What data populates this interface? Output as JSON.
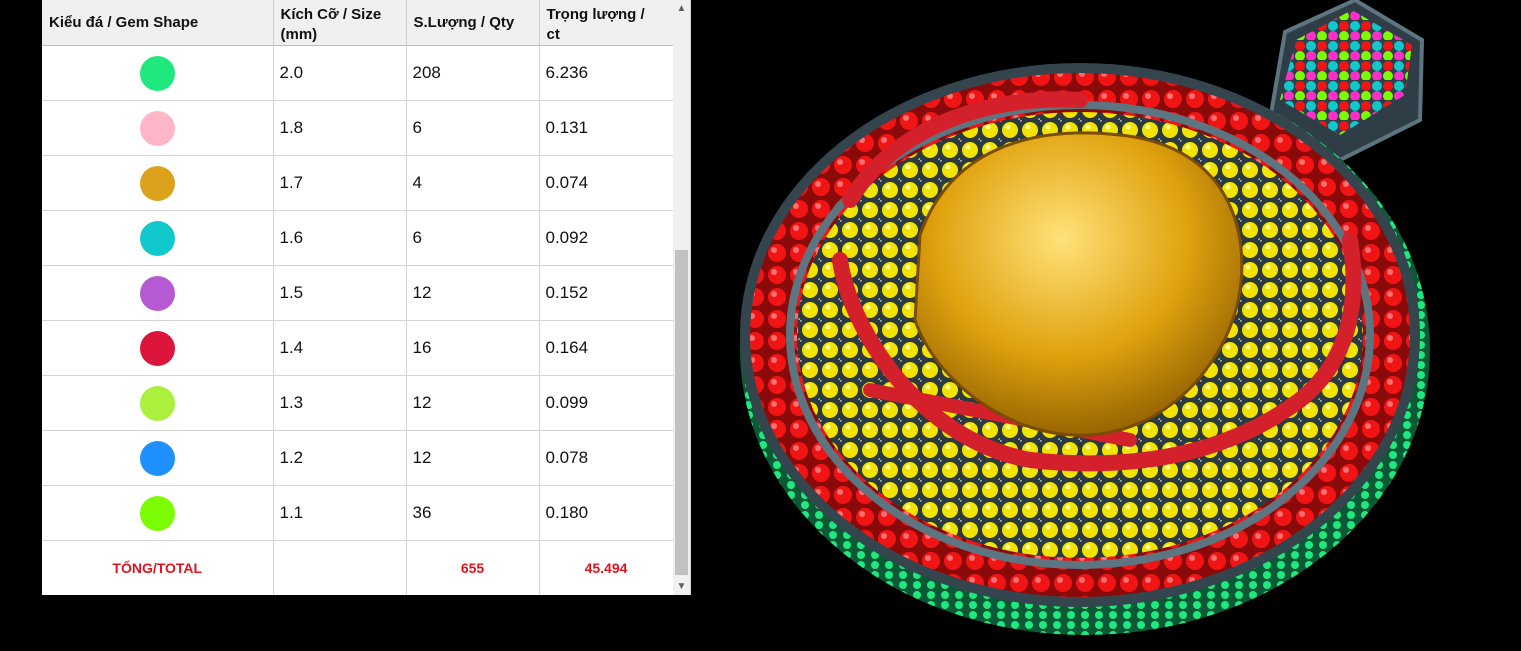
{
  "table": {
    "headers": {
      "shape": "Kiểu đá / Gem Shape",
      "size_line1": "Kích Cỡ / Size",
      "size_line2": "(mm)",
      "qty": "S.Lượng / Qty",
      "weight_line1": "Trọng lượng /",
      "weight_line2": "ct"
    },
    "rows": [
      {
        "color": "#1ee87e",
        "size": "2.0",
        "qty": "208",
        "weight": "6.236"
      },
      {
        "color": "#ffb6c8",
        "size": "1.8",
        "qty": "6",
        "weight": "0.131"
      },
      {
        "color": "#dca21e",
        "size": "1.7",
        "qty": "4",
        "weight": "0.074"
      },
      {
        "color": "#11c8cc",
        "size": "1.6",
        "qty": "6",
        "weight": "0.092"
      },
      {
        "color": "#b65ad4",
        "size": "1.5",
        "qty": "12",
        "weight": "0.152"
      },
      {
        "color": "#dc143c",
        "size": "1.4",
        "qty": "16",
        "weight": "0.164"
      },
      {
        "color": "#aaf03c",
        "size": "1.3",
        "qty": "12",
        "weight": "0.099"
      },
      {
        "color": "#1e90ff",
        "size": "1.2",
        "qty": "12",
        "weight": "0.078"
      },
      {
        "color": "#7cfc00",
        "size": "1.1",
        "qty": "36",
        "weight": "0.180"
      }
    ],
    "total": {
      "label": "TỔNG/TOTAL",
      "size": "",
      "qty": "655",
      "weight": "45.494"
    }
  },
  "colors": {
    "total_text": "#e0141e",
    "background": "#000000"
  },
  "icons": {
    "scroll_up": "chevron-up-icon",
    "scroll_down": "chevron-down-icon"
  }
}
